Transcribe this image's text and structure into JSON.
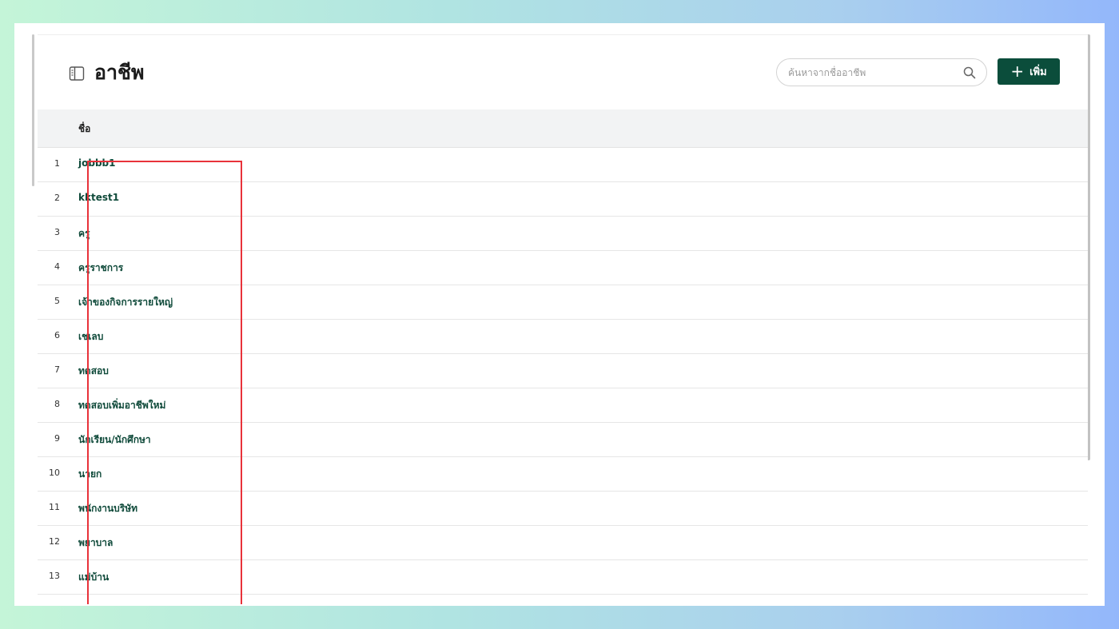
{
  "header": {
    "title": "อาชีพ",
    "title_icon": "sidebar-panel-icon"
  },
  "search": {
    "placeholder": "ค้นหาจากชื่ออาชีพ",
    "value": "",
    "icon": "search-icon"
  },
  "toolbar": {
    "add_label": "เพิ่ม",
    "add_icon": "plus-icon"
  },
  "table": {
    "columns": [
      "ชื่อ"
    ],
    "rows": [
      {
        "num": "1",
        "name": "jobbb1"
      },
      {
        "num": "2",
        "name": "kktest1"
      },
      {
        "num": "3",
        "name": "ครู"
      },
      {
        "num": "4",
        "name": "ครูราชการ"
      },
      {
        "num": "5",
        "name": "เจ้าของกิจการรายใหญ่"
      },
      {
        "num": "6",
        "name": "เชเลบ"
      },
      {
        "num": "7",
        "name": "ทดสอบ"
      },
      {
        "num": "8",
        "name": "ทดสอบเพิ่มอาชีพใหม่"
      },
      {
        "num": "9",
        "name": "นักเรียน/นักศึกษา"
      },
      {
        "num": "10",
        "name": "นายก"
      },
      {
        "num": "11",
        "name": "พนักงานบริษัท"
      },
      {
        "num": "12",
        "name": "พยาบาล"
      },
      {
        "num": "13",
        "name": "แม่บ้าน"
      }
    ]
  },
  "colors": {
    "accent": "#0b4d3b",
    "row_text": "#0f4a3a",
    "highlight": "#e8323a",
    "header_bg": "#f2f3f4"
  }
}
